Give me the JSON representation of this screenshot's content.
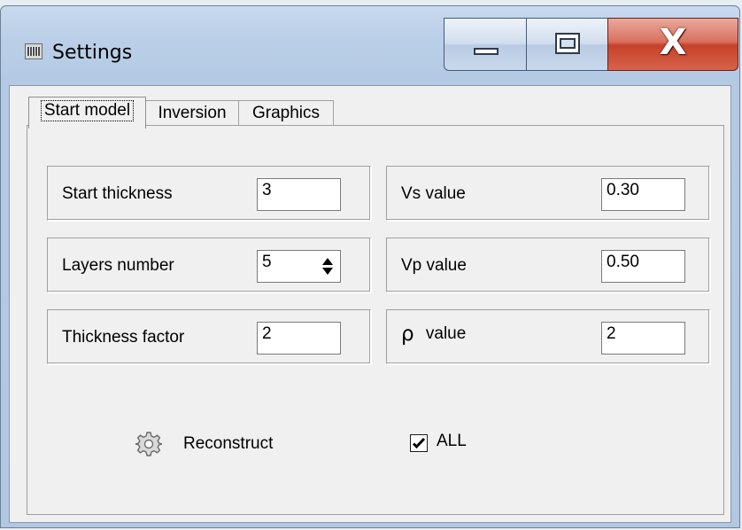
{
  "window": {
    "title": "Settings",
    "icon": "app-settings-icon",
    "controls": {
      "minimize": "minimize-icon",
      "maximize": "maximize-icon",
      "close": "X"
    }
  },
  "tabs": [
    {
      "label": "Start model",
      "active": true
    },
    {
      "label": "Inversion",
      "active": false
    },
    {
      "label": "Graphics",
      "active": false
    }
  ],
  "start_model": {
    "start_thickness": {
      "label": "Start thickness",
      "value": "3"
    },
    "layers_number": {
      "label": "Layers number",
      "value": "5"
    },
    "thickness_factor": {
      "label": "Thickness factor",
      "value": "2"
    },
    "vs": {
      "label": "Vs value",
      "value": "0.30"
    },
    "vp": {
      "label": "Vp value",
      "value": "0.50"
    },
    "rho": {
      "symbol": "ρ",
      "label": "value",
      "value": "2"
    },
    "reconstruct": {
      "label": "Reconstruct",
      "icon": "gear-icon"
    },
    "all": {
      "label": "ALL",
      "checked": true
    }
  },
  "colors": {
    "title_bar": "#bcd0e8",
    "close_button": "#c7412a",
    "client_bg": "#f0f0f0"
  }
}
